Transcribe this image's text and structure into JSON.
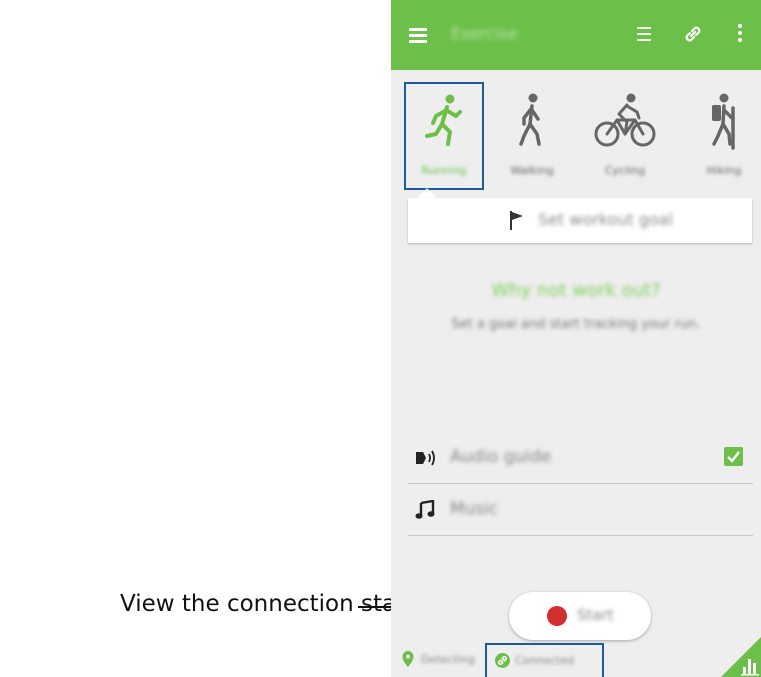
{
  "caption": "View the connection status.",
  "appbar": {
    "title": "Exercise",
    "icons": [
      "menu-icon",
      "list-icon",
      "link-icon",
      "more-vert-icon"
    ]
  },
  "activities": [
    {
      "label": "Running",
      "icon": "running-icon",
      "selected": true
    },
    {
      "label": "Walking",
      "icon": "walking-icon",
      "selected": false
    },
    {
      "label": "Cycling",
      "icon": "cycling-icon",
      "selected": false
    },
    {
      "label": "Hiking",
      "icon": "hiking-icon",
      "selected": false
    }
  ],
  "goal": {
    "label": "Set workout goal",
    "icon": "flag-icon"
  },
  "prompt": {
    "title": "Why not work out?",
    "subtitle": "Set a goal and start tracking your run."
  },
  "settings": [
    {
      "label": "Audio guide",
      "icon": "audio-guide-icon",
      "checked": true
    },
    {
      "label": "Music",
      "icon": "music-icon"
    }
  ],
  "start": {
    "label": "Start"
  },
  "status": {
    "gps": "Detecting",
    "connection": "Connected"
  },
  "colors": {
    "accent": "#6cc04a",
    "highlight": "#1f5a9a",
    "record": "#d32f2f"
  }
}
